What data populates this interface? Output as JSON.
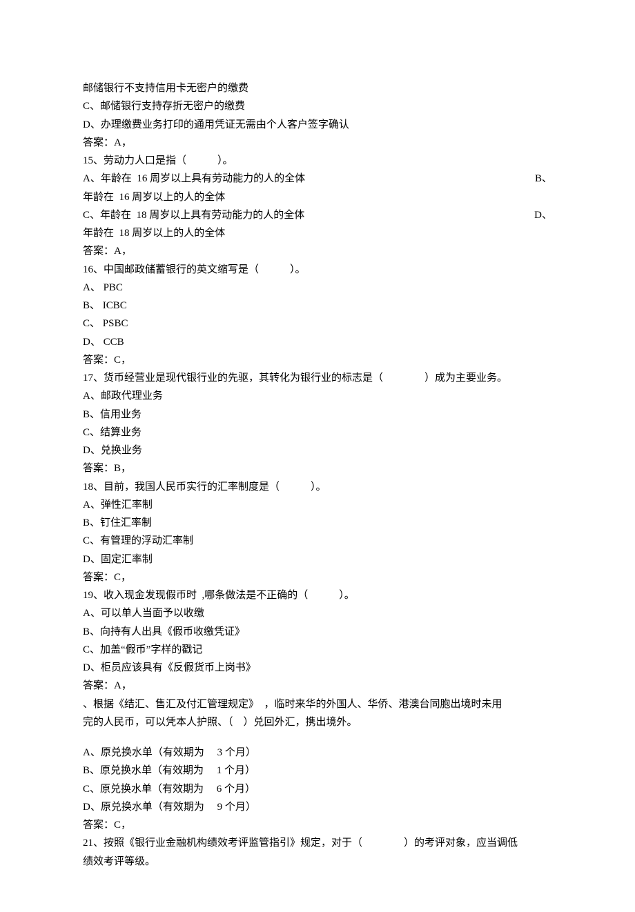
{
  "intro": {
    "lineA": "邮储银行不支持信用卡无密户的缴费",
    "lineB": "C、邮储银行支持存折无密户的缴费",
    "lineC": "D、办理缴费业务打印的通用凭证无需由个人客户签字确认",
    "answer": "答案：A，"
  },
  "q15": {
    "stem": "15、劳动力人口是指（　　　）。",
    "optA": "A、年龄在 16 周岁以上具有劳动能力的人的全体",
    "optA_tail": "B、",
    "optA2": "年龄在 16 周岁以上的人的全体",
    "optC": "C、年龄在 18 周岁以上具有劳动能力的人的全体",
    "optC_tail": "D、",
    "optC2": "年龄在 18 周岁以上的人的全体",
    "answer": "答案：A，"
  },
  "q16": {
    "stem": "16、中国邮政储蓄银行的英文缩写是（　　　）。",
    "A": "A、 PBC",
    "B": "B、 ICBC",
    "C": "C、 PSBC",
    "D": "D、 CCB",
    "answer": "答案：C，"
  },
  "q17": {
    "stem": "17、货币经营业是现代银行业的先驱，其转化为银行业的标志是（　　　　）成为主要业务。",
    "A": "A、邮政代理业务",
    "B": "B、信用业务",
    "C": "C、结算业务",
    "D": "D、兑换业务",
    "answer": "答案：B，"
  },
  "q18": {
    "stem": "18、目前，我国人民币实行的汇率制度是（　　　）。",
    "A": "A、弹性汇率制",
    "B": "B、钉住汇率制",
    "C": "C、有管理的浮动汇率制",
    "D": "D、固定汇率制",
    "answer": "答案：C，"
  },
  "q19": {
    "stem": "19、收入现金发现假币时 ,哪条做法是不正确的（　　　）。",
    "A": "A、可以单人当面予以收缴",
    "B": "B、向持有人出具《假币收缴凭证》",
    "C": "C、加盖“假币”字样的戳记",
    "D": "D、柜员应该具有《反假货币上岗书》",
    "answer": "答案：A，"
  },
  "q20": {
    "stem1": "、根据《结汇、售汇及付汇管理规定》　，临时来华的外国人、华侨、港澳台同胞出境时未用",
    "stem2": "完的人民币，可以凭本人护照、（　）兑回外汇，携出境外。",
    "A": "A、原兑换水单（有效期为　 3 个月）",
    "B": "B、原兑换水单（有效期为　 1 个月）",
    "C": "C、原兑换水单（有效期为　 6 个月）",
    "D": "D、原兑换水单（有效期为　 9 个月）",
    "answer": "答案：C，"
  },
  "q21": {
    "stem1": "21、按照《银行业金融机构绩效考评监管指引》规定，对于（　　　　）的考评对象，应当调低",
    "stem2": "绩效考评等级。"
  }
}
